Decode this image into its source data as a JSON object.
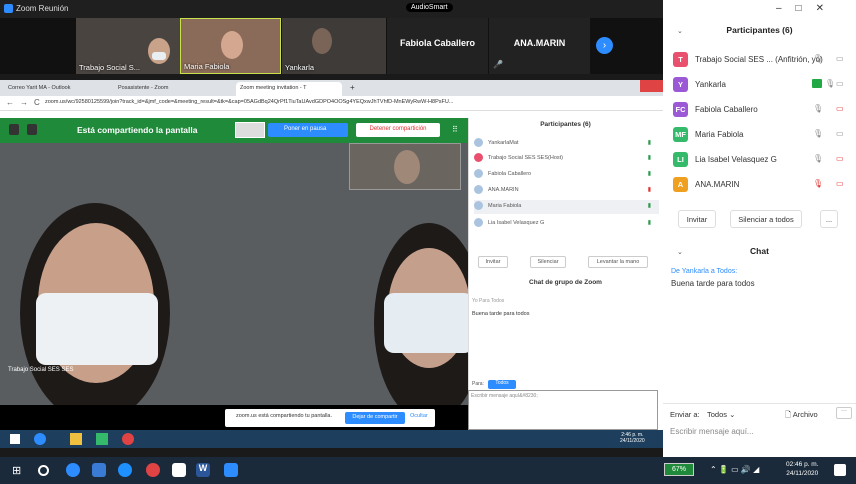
{
  "window": {
    "title": "Zoom Reunión",
    "badge": "AudioSmart"
  },
  "gallery": [
    {
      "name": "Trabajo Social S..."
    },
    {
      "name": "Maria Fabiola"
    },
    {
      "name": "Yankarla"
    },
    {
      "name": "Fabiola Caballero"
    },
    {
      "name": "ANA.MARIN"
    }
  ],
  "browser": {
    "tabs": [
      "Correo Yarit MA - Outlook",
      "Posasistente - Zoom",
      "Zoom meeting invitation - T"
    ],
    "url": "zoom.us/wc/92580125599/join?track_id=&jmf_code=&meeting_result=&tk=&cap=05AGdBq24QrPf1TiuTaUAvdGDPO4OOSg4YEQxwJhTVhfD-MnEWyRwW-H8PsFU..."
  },
  "share": {
    "status": "Está compartiendo la pantalla",
    "pause": "Poner en pausa",
    "stop": "Detener compartición",
    "speaker": "Trabajo Social SES SES",
    "notice": "zoom.us está compartiendo tu pantalla.",
    "stop_share": "Dejar de compartir",
    "hide": "Ocultar"
  },
  "inner_panel": {
    "title": "Participantes (6)",
    "participants": [
      "YankarlaMat",
      "Trabajo Social SES SES(Host)",
      "Fabiola Caballero",
      "ANA.MARIN",
      "Maria Fabiola",
      "Lia Isabel Velasquez G"
    ],
    "buttons": [
      "Invitar",
      "Silenciar",
      "Levantar la mano"
    ],
    "chat_title": "Chat de grupo de Zoom",
    "chat_from": "Yo Para Todos",
    "chat_msg": "Buena tarde para todos",
    "to_label": "Para:",
    "to_value": "Todos",
    "input_placeholder": "Escribir mensaje aquí&#8230;"
  },
  "inner_taskbar": {
    "time": "2:46 p. m.",
    "date": "24/11/2020"
  },
  "panel": {
    "title": "Participantes (6)",
    "participants": [
      {
        "initial": "T",
        "name": "Trabajo Social SES ... (Anfitrión, yo)",
        "color": "#e8506e"
      },
      {
        "initial": "Y",
        "name": "Yankarla",
        "color": "#9b59d6"
      },
      {
        "initial": "FC",
        "name": "Fabiola Caballero",
        "color": "#9b59d6"
      },
      {
        "initial": "MF",
        "name": "Maria Fabiola",
        "color": "#35b96a"
      },
      {
        "initial": "LI",
        "name": "Lia Isabel Velasquez G",
        "color": "#35b96a"
      },
      {
        "initial": "A",
        "name": "ANA.MARIN",
        "color": "#f0a020"
      }
    ],
    "buttons": [
      "Invitar",
      "Silenciar a todos",
      "..."
    ]
  },
  "chat": {
    "title": "Chat",
    "from": "De Yankarla a Todos:",
    "message": "Buena tarde para todos",
    "send_to_label": "Enviar a:",
    "send_to_value": "Todos",
    "file_label": "Archivo",
    "input_placeholder": "Escribir mensaje aquí..."
  },
  "taskbar": {
    "battery": "67%",
    "time": "02:46 p. m.",
    "date": "24/11/2020"
  }
}
